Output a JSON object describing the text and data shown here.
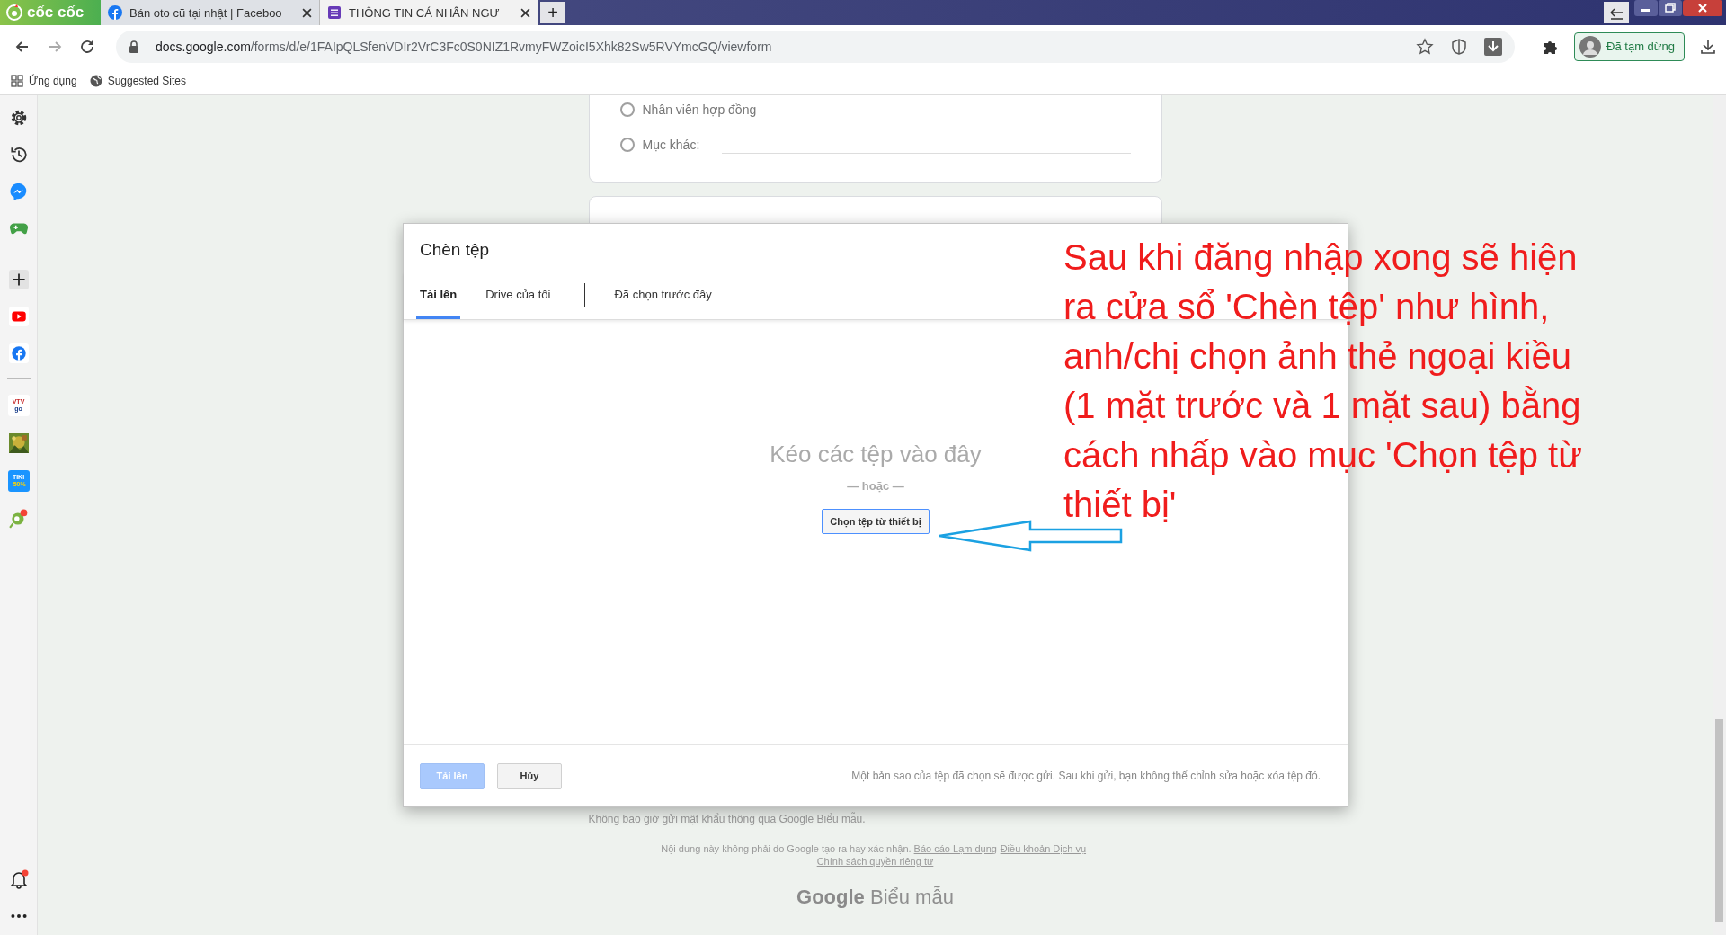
{
  "browser": {
    "brand": "cốc cốc",
    "tabs": [
      {
        "label": "Bán oto cũ tại nhật | Faceboo",
        "kind": "facebook",
        "selected": false
      },
      {
        "label": "THÔNG TIN CÁ NHÂN NGƯ",
        "kind": "forms",
        "selected": true
      }
    ],
    "new_tab": "+",
    "url_host": "docs.google.com",
    "url_path": "/forms/d/e/1FAIpQLSfenVDIr2VrC3Fc0S0NIZ1RvmyFWZoicI5Xhk82Sw5RVYmcGQ/viewform",
    "profile_button": "Đã tạm dừng",
    "bookmarks": [
      {
        "label": "Ứng dụng",
        "kind": "apps"
      },
      {
        "label": "Suggested Sites",
        "kind": "globe"
      }
    ]
  },
  "sidebar": {
    "items": [
      {
        "kind": "settings"
      },
      {
        "kind": "history"
      },
      {
        "kind": "messenger"
      },
      {
        "kind": "games"
      },
      {
        "kind": "divider"
      },
      {
        "kind": "add"
      },
      {
        "kind": "youtube"
      },
      {
        "kind": "facebook"
      },
      {
        "kind": "divider"
      },
      {
        "kind": "vtv",
        "label": "VTV",
        "sub": "go"
      },
      {
        "kind": "picture"
      },
      {
        "kind": "tiki",
        "label": "TIKI",
        "sub": "-50%"
      },
      {
        "kind": "extension"
      }
    ],
    "bottom": [
      {
        "kind": "bell",
        "badge": true
      },
      {
        "kind": "more"
      }
    ]
  },
  "form": {
    "options": [
      {
        "label": "Nhân viên hợp đồng",
        "kind": "plain",
        "selected": false
      },
      {
        "label": "Mục khác:",
        "kind": "other",
        "selected": false
      }
    ],
    "warning": "Không bao giờ gửi mật khẩu thông qua Google Biểu mẫu.",
    "disclaimer": "Nội dung này không phải do Google tạo ra hay xác nhận.",
    "links": [
      "Báo cáo Lạm dụng",
      "Điều khoản Dịch vụ",
      "Chính sách quyền riêng tư"
    ],
    "link_separator": "-",
    "logo_google": "Google",
    "logo_product": "Biểu mẫu"
  },
  "dialog": {
    "title": "Chèn tệp",
    "tabs": [
      {
        "label": "Tải lên",
        "selected": true
      },
      {
        "label": "Drive của tôi",
        "selected": false
      },
      {
        "label": "Đã chọn trước đây",
        "selected": false
      }
    ],
    "drop_text": "Kéo các tệp vào đây",
    "or_text": "— hoặc —",
    "choose_button": "Chọn tệp từ thiết bị",
    "buttons": [
      {
        "label": "Tải lên",
        "kind": "primary",
        "disabled": true
      },
      {
        "label": "Hủy",
        "kind": "secondary",
        "disabled": false
      }
    ],
    "note": "Một bản sao của tệp đã chọn sẽ được gửi. Sau khi gửi, bạn không thể chỉnh sửa hoặc xóa tệp đó."
  },
  "annotation": {
    "text": "Sau khi đăng nhập xong sẽ hiện ra cửa sổ 'Chèn tệp' như hình, anh/chị chọn ảnh thẻ ngoại kiều (1 mặt trước và 1 mặt sau) bằng cách nhấp vào mục 'Chọn tệp từ thiết bị'"
  }
}
